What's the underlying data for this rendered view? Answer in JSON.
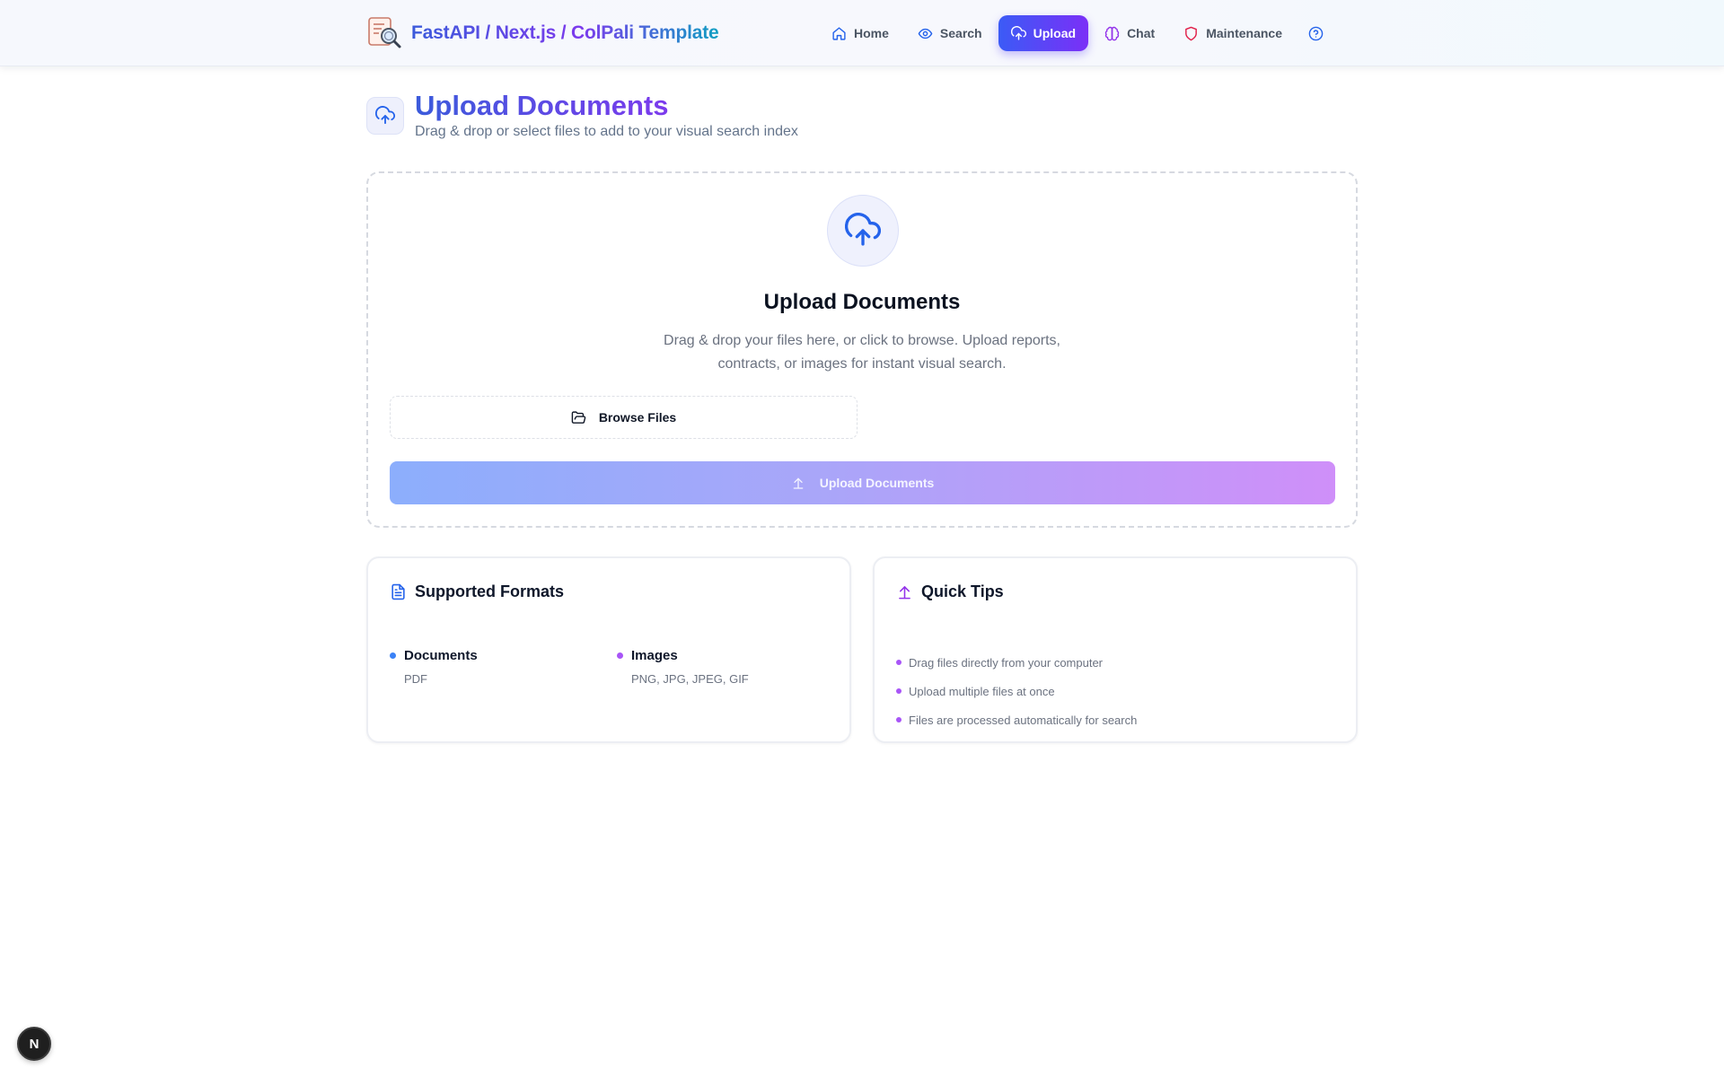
{
  "app": {
    "title": "FastAPI / Next.js / ColPali Template",
    "logo_icon": "document-search-icon"
  },
  "nav": {
    "items": [
      {
        "label": "Home",
        "icon": "home-icon",
        "active": false
      },
      {
        "label": "Search",
        "icon": "eye-icon",
        "active": false
      },
      {
        "label": "Upload",
        "icon": "cloud-upload-icon",
        "active": true
      },
      {
        "label": "Chat",
        "icon": "brain-icon",
        "active": false
      },
      {
        "label": "Maintenance",
        "icon": "shield-icon",
        "active": false
      }
    ],
    "help_icon": "help-circle-icon"
  },
  "page": {
    "title": "Upload Documents",
    "subtitle": "Drag & drop or select files to add to your visual search index",
    "icon": "cloud-upload-icon"
  },
  "dropzone": {
    "title": "Upload Documents",
    "description": "Drag & drop your files here, or click to browse. Upload reports, contracts, or images for instant visual search.",
    "browse_label": "Browse Files",
    "upload_label": "Upload Documents",
    "upload_disabled": true
  },
  "formats": {
    "title": "Supported Formats",
    "items": [
      {
        "name": "Documents",
        "types": "PDF",
        "color": "#3b82f6"
      },
      {
        "name": "Images",
        "types": "PNG, JPG, JPEG, GIF",
        "color": "#a855f7"
      }
    ]
  },
  "tips": {
    "title": "Quick Tips",
    "items": [
      "Drag files directly from your computer",
      "Upload multiple files at once",
      "Files are processed automatically for search"
    ]
  },
  "dev_badge": {
    "label": "N"
  },
  "colors": {
    "accent_start": "#3b5bf6",
    "accent_end": "#7b2ff7",
    "documents_dot": "#3b82f6",
    "images_dot": "#a855f7",
    "maintenance_icon": "#e11d48"
  }
}
